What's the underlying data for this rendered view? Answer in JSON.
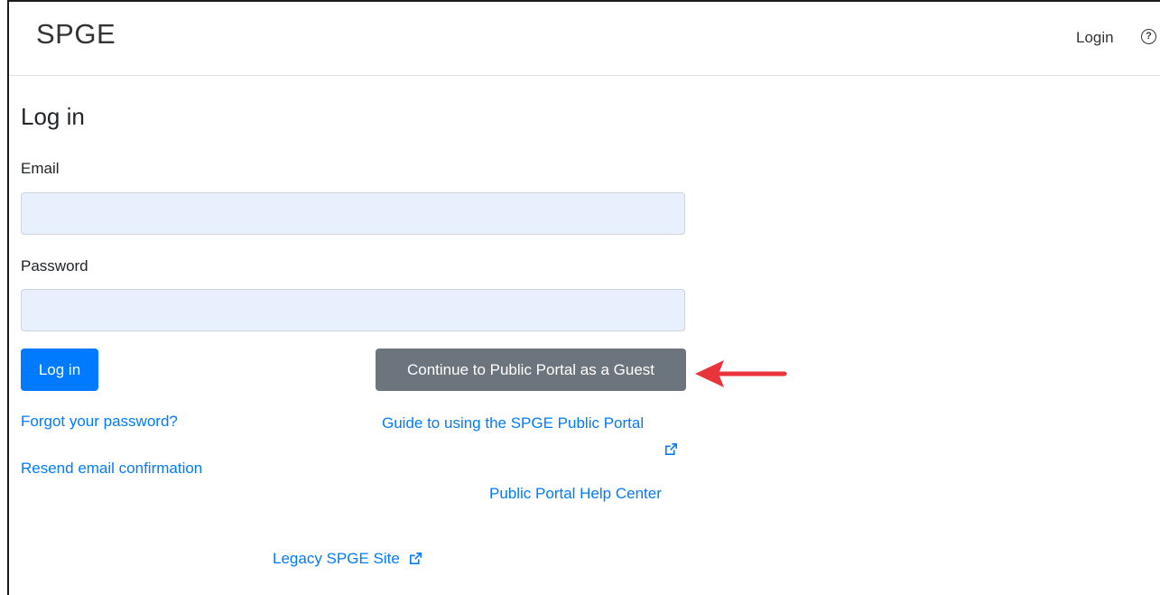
{
  "header": {
    "brand": "SPGE",
    "login_link": "Login",
    "help_icon": "question-circle-icon",
    "help_glyph": "?"
  },
  "main": {
    "title": "Log in",
    "email": {
      "label": "Email",
      "value": "",
      "placeholder": ""
    },
    "password": {
      "label": "Password",
      "value": "",
      "placeholder": ""
    },
    "login_button": "Log in",
    "guest_button": "Continue to Public Portal as a Guest",
    "links": {
      "forgot_password": "Forgot your password?",
      "resend_confirmation": "Resend email confirmation",
      "guide": "Guide to using the SPGE Public Portal",
      "help_center": "Public Portal Help Center",
      "legacy_site": "Legacy SPGE Site"
    },
    "external_icon": "external-link-icon"
  },
  "annotation": {
    "type": "red-arrow-pointing-left",
    "color": "#e8343a"
  },
  "colors": {
    "primary": "#007bff",
    "secondary": "#6c757d",
    "input_bg": "#e8f0fe",
    "text": "#212529"
  }
}
